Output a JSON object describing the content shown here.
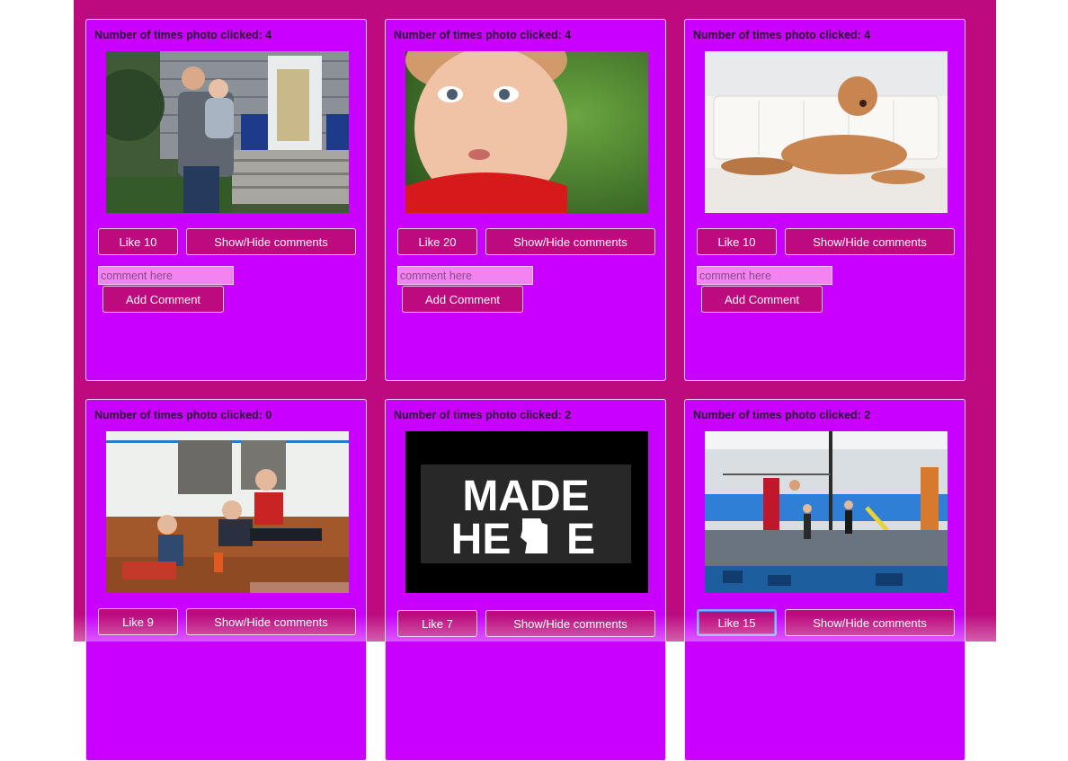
{
  "cards": [
    {
      "clicks_label": "Number of times photo clicked: 4",
      "photo_icon": "family-photo",
      "like_label": "Like 10",
      "toggle_label": "Show/Hide comments",
      "comment_placeholder": "comment here",
      "add_label": "Add Comment"
    },
    {
      "clicks_label": "Number of times photo clicked: 4",
      "photo_icon": "toddler-photo",
      "like_label": "Like 20",
      "toggle_label": "Show/Hide comments",
      "comment_placeholder": "comment here",
      "add_label": "Add Comment"
    },
    {
      "clicks_label": "Number of times photo clicked: 4",
      "photo_icon": "dog-photo",
      "like_label": "Like 10",
      "toggle_label": "Show/Hide comments",
      "comment_placeholder": "comment here",
      "add_label": "Add Comment"
    },
    {
      "clicks_label": "Number of times photo clicked: 0",
      "photo_icon": "kids-playing-photo",
      "like_label": "Like 9",
      "toggle_label": "Show/Hide comments"
    },
    {
      "clicks_label": "Number of times photo clicked: 2",
      "photo_icon": "made-here-logo-photo",
      "photo_text_line1": "MADE",
      "photo_text_line2": "HE",
      "photo_text_line2b": "E",
      "like_label": "Like 7",
      "toggle_label": "Show/Hide comments"
    },
    {
      "clicks_label": "Number of times photo clicked: 2",
      "photo_icon": "gymnastics-photo",
      "like_label": "Like 15",
      "toggle_label": "Show/Hide comments"
    }
  ],
  "colors": {
    "page_background": "#bd0a7f",
    "card_background": "#c900ff",
    "button_background": "#bd0a7f",
    "input_background": "#f283f0"
  }
}
